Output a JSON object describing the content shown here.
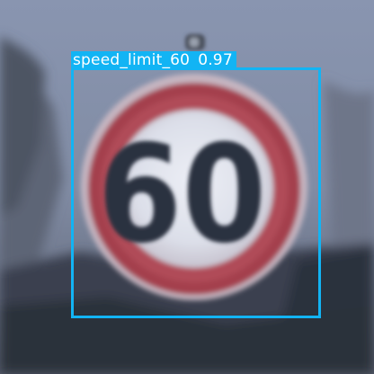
{
  "image": {
    "subject": "speed-limit-sign",
    "colors": {
      "sky": "#8692ab",
      "sign_ring": "#a0444f",
      "sign_face": "#e6e8f1",
      "digits": "#2a3140",
      "trees": "#333a45",
      "box": "#12b4f4"
    }
  },
  "detections": [
    {
      "label": "speed_limit_60",
      "score": "0.97"
    }
  ],
  "sign": {
    "text": "60"
  }
}
